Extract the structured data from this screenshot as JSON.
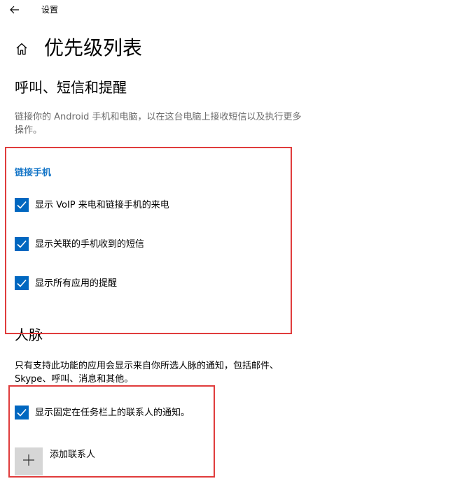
{
  "titlebar": {
    "back_icon": "arrow-left-icon",
    "app_title": "设置"
  },
  "header": {
    "home_icon": "home-icon",
    "page_title": "优先级列表"
  },
  "calls_section": {
    "title": "呼叫、短信和提醒",
    "description_line1": "链接你的 Android 手机和电脑，以在这台电脑上接收短信以及执行更多",
    "description_line2": "操作。",
    "group_label": "链接手机",
    "options": [
      {
        "label": "显示 VoIP 来电和链接手机的来电",
        "checked": true
      },
      {
        "label": "显示关联的手机收到的短信",
        "checked": true
      },
      {
        "label": "显示所有应用的提醒",
        "checked": true
      }
    ]
  },
  "people_section": {
    "title": "人脉",
    "description_line1": "只有支持此功能的应用会显示来自你所选人脉的通知，包括邮件、",
    "description_line2": "Skype、呼叫、消息和其他。",
    "options": [
      {
        "label": "显示固定在任务栏上的联系人的通知。",
        "checked": true
      }
    ],
    "add_contact_label": "添加联系人",
    "add_icon": "plus-icon"
  },
  "colors": {
    "accent": "#0067c0",
    "link_blue": "#1274c7",
    "highlight_red": "#e03c3c",
    "description_gray": "#6b6b6b",
    "tile_gray": "#d6d6d6"
  }
}
